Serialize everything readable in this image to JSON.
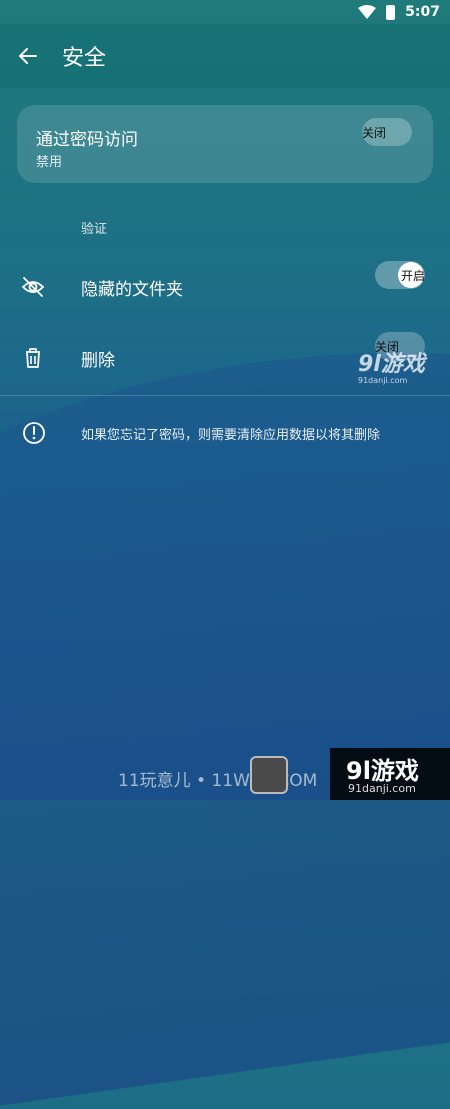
{
  "status_bar": {
    "time": "5:07",
    "icons": [
      "wifi-icon",
      "battery-icon"
    ]
  },
  "app_bar": {
    "title": "安全",
    "back_icon": "arrow-left-icon"
  },
  "password_access": {
    "title": "通过密码访问",
    "subtitle": "禁用",
    "toggle_label": "关闭",
    "toggle_on": false
  },
  "section_header": "验证",
  "rows": [
    {
      "label": "隐藏的文件夹",
      "icon": "eye-off-icon",
      "toggle_label": "开启",
      "toggle_on": true
    },
    {
      "label": "删除",
      "icon": "trash-icon",
      "toggle_label": "关闭",
      "toggle_on": false
    }
  ],
  "info": {
    "icon": "info-icon",
    "text": "如果您忘记了密码，则需要清除应用数据以将其删除"
  },
  "watermarks": {
    "mid_logo": "9l游戏",
    "mid_domain": "91danji.com",
    "footer_text": "11玩意儿 • 11WYX.COM",
    "brand_main": "9l游戏",
    "brand_sub": "91danji.com"
  }
}
